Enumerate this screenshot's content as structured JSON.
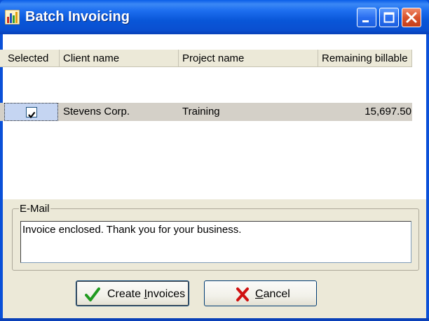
{
  "window": {
    "title": "Batch Invoicing",
    "app_icon": "bar-chart-icon",
    "controls": [
      "minimize-icon",
      "maximize-icon",
      "close-icon"
    ]
  },
  "grid": {
    "columns": [
      "Selected",
      "Client name",
      "Project name",
      "Remaining billable"
    ],
    "rows": [
      {
        "selected": true,
        "client_name": "Stevens Corp.",
        "project_name": "Training",
        "remaining_billable": "15,697.50"
      }
    ]
  },
  "email": {
    "group_label": "E-Mail",
    "message": "Invoice enclosed. Thank you for your business."
  },
  "buttons": {
    "create": {
      "label_pre": "Create ",
      "label_ul": "I",
      "label_post": "nvoices",
      "icon": "green-check-icon"
    },
    "cancel": {
      "label_pre": "",
      "label_ul": "C",
      "label_post": "ancel",
      "icon": "red-x-icon"
    }
  },
  "colors": {
    "titlebar": "#0a56d8",
    "dialog_face": "#ece9d8",
    "check_green": "#1f9a1f",
    "cancel_red": "#d01010"
  }
}
